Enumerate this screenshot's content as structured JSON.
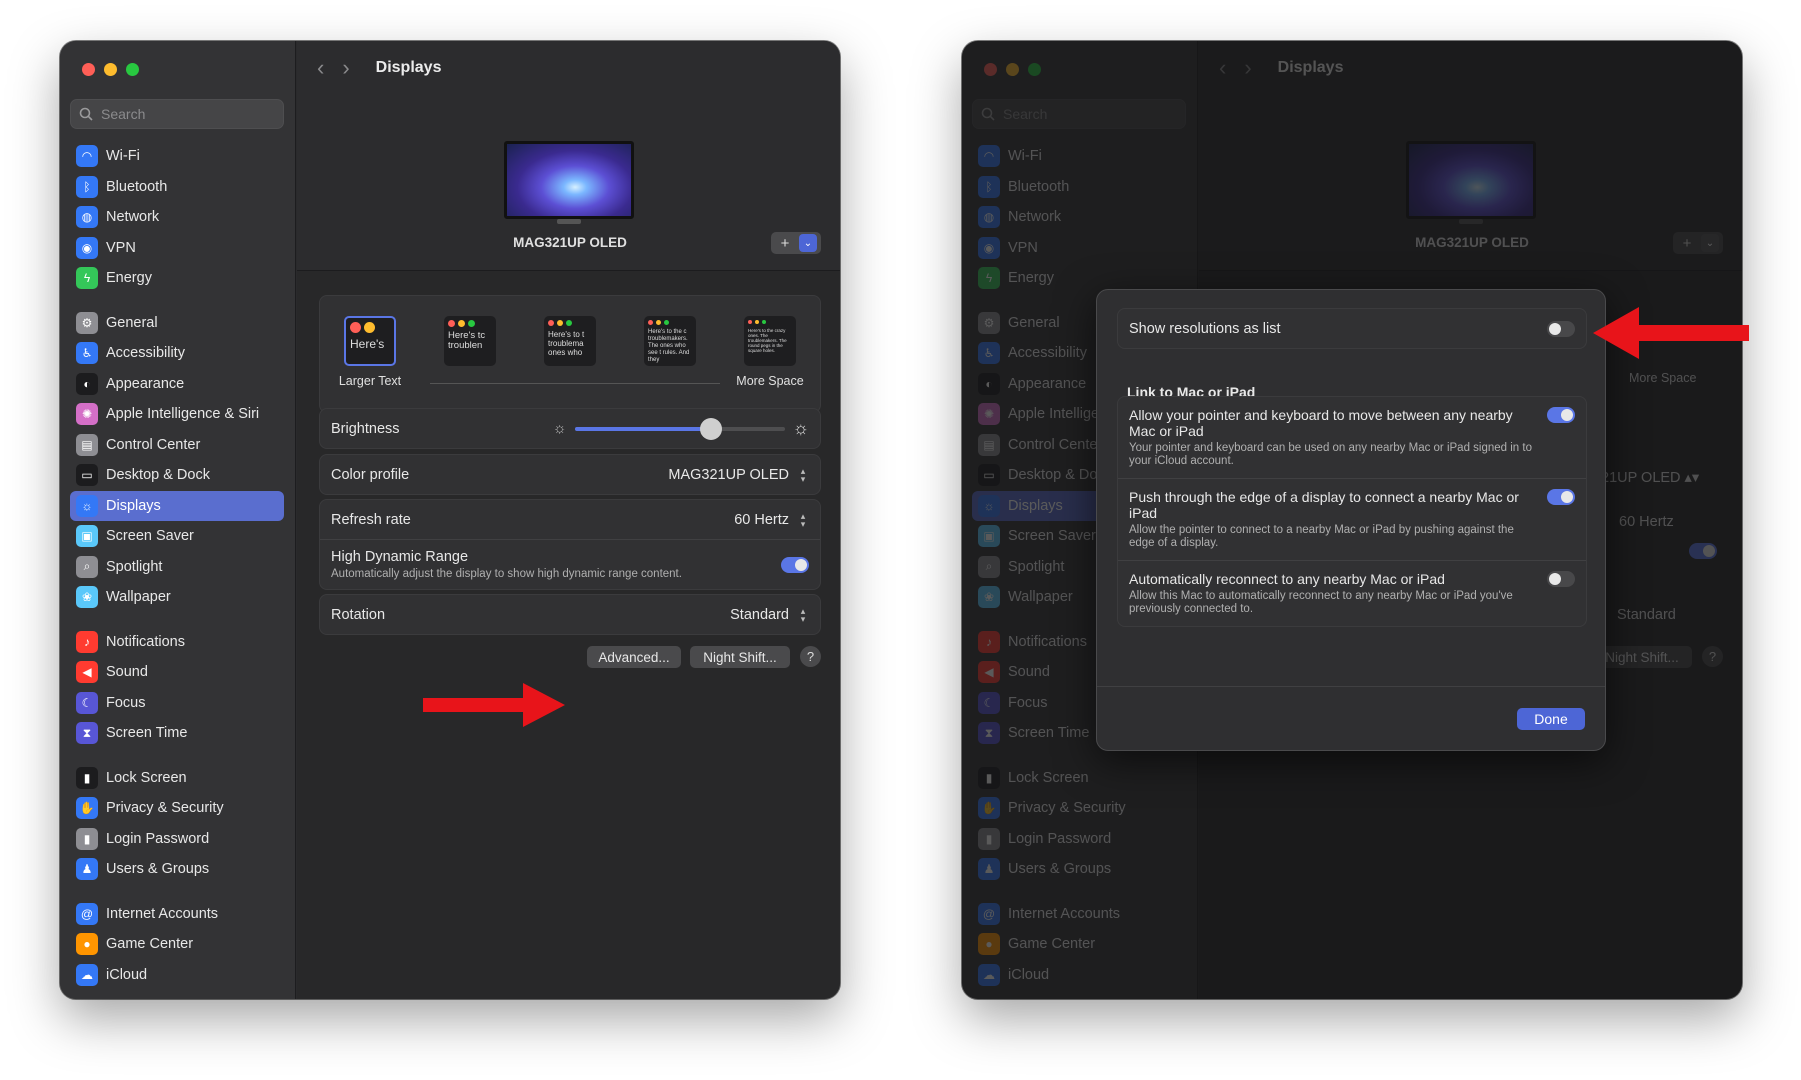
{
  "window_title": "Displays",
  "search_placeholder": "Search",
  "sidebar": [
    {
      "label": "Wi-Fi",
      "icon": "wifi-icon",
      "color": "#3478f6"
    },
    {
      "label": "Bluetooth",
      "icon": "bluetooth-icon",
      "color": "#3478f6"
    },
    {
      "label": "Network",
      "icon": "globe-icon",
      "color": "#3478f6"
    },
    {
      "label": "VPN",
      "icon": "vpn-icon",
      "color": "#3478f6"
    },
    {
      "label": "Energy",
      "icon": "energy-icon",
      "color": "#34c759"
    },
    {
      "label": "General",
      "icon": "gear-icon",
      "color": "#8e8e93"
    },
    {
      "label": "Accessibility",
      "icon": "accessibility-icon",
      "color": "#3478f6"
    },
    {
      "label": "Appearance",
      "icon": "appearance-icon",
      "color": "#1c1c1e"
    },
    {
      "label": "Apple Intelligence & Siri",
      "icon": "siri-icon",
      "color": "#d46fc7"
    },
    {
      "label": "Control Center",
      "icon": "control-center-icon",
      "color": "#8e8e93"
    },
    {
      "label": "Desktop & Dock",
      "icon": "dock-icon",
      "color": "#1c1c1e"
    },
    {
      "label": "Displays",
      "icon": "sun-icon",
      "color": "#3478f6"
    },
    {
      "label": "Screen Saver",
      "icon": "screensaver-icon",
      "color": "#5ac8fa"
    },
    {
      "label": "Spotlight",
      "icon": "spotlight-icon",
      "color": "#8e8e93"
    },
    {
      "label": "Wallpaper",
      "icon": "wallpaper-icon",
      "color": "#5ac8fa"
    },
    {
      "label": "Notifications",
      "icon": "bell-icon",
      "color": "#ff3b30"
    },
    {
      "label": "Sound",
      "icon": "sound-icon",
      "color": "#ff3b30"
    },
    {
      "label": "Focus",
      "icon": "moon-icon",
      "color": "#5856d6"
    },
    {
      "label": "Screen Time",
      "icon": "hourglass-icon",
      "color": "#5856d6"
    },
    {
      "label": "Lock Screen",
      "icon": "lock-icon",
      "color": "#1c1c1e"
    },
    {
      "label": "Privacy & Security",
      "icon": "hand-icon",
      "color": "#3478f6"
    },
    {
      "label": "Login Password",
      "icon": "padlock-icon",
      "color": "#8e8e93"
    },
    {
      "label": "Users & Groups",
      "icon": "users-icon",
      "color": "#3478f6"
    },
    {
      "label": "Internet Accounts",
      "icon": "at-icon",
      "color": "#3478f6"
    },
    {
      "label": "Game Center",
      "icon": "game-center-icon",
      "color": "#ff9500"
    },
    {
      "label": "iCloud",
      "icon": "cloud-icon",
      "color": "#3478f6"
    }
  ],
  "display": {
    "name": "MAG321UP OLED",
    "sizes": {
      "larger": "Larger Text",
      "more": "More Space"
    },
    "thumb_text": [
      "Here's",
      "Here's tc troublen",
      "Here's to t troublema ones who",
      "Here's to the c troublemakers. The ones who see t rules. And they",
      "Here's to the crazy ones. The troublemakers. The round pegs in the square holes."
    ],
    "brightness_label": "Brightness",
    "brightness_level": 0.65,
    "color_profile_label": "Color profile",
    "color_profile_value": "MAG321UP OLED",
    "refresh_label": "Refresh rate",
    "refresh_value": "60 Hertz",
    "hdr_label": "High Dynamic Range",
    "hdr_sub": "Automatically adjust the display to show high dynamic range content.",
    "rotation_label": "Rotation",
    "rotation_value": "Standard",
    "advanced_btn": "Advanced...",
    "nightshift_btn": "Night Shift...",
    "help": "?"
  },
  "advanced": {
    "show_list_label": "Show resolutions as list",
    "link_heading": "Link to Mac or iPad",
    "opt1_title": "Allow your pointer and keyboard to move between any nearby Mac or iPad",
    "opt1_sub": "Your pointer and keyboard can be used on any nearby Mac or iPad signed in to your iCloud account.",
    "opt2_title": "Push through the edge of a display to connect a nearby Mac or iPad",
    "opt2_sub": "Allow the pointer to connect to a nearby Mac or iPad by pushing against the edge of a display.",
    "opt3_title": "Automatically reconnect to any nearby Mac or iPad",
    "opt3_sub": "Allow this Mac to automatically reconnect to any nearby Mac or iPad you've previously connected to.",
    "done": "Done"
  },
  "colors": {
    "accent": "#5a76e6",
    "arrow": "#e8141a"
  }
}
